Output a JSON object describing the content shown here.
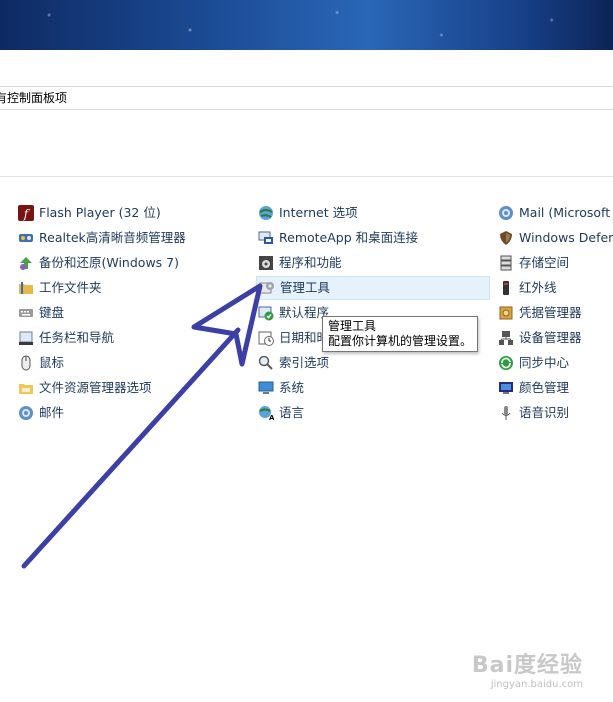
{
  "address_bar": {
    "text": "有控制面板项"
  },
  "columns": {
    "left": [
      {
        "label": "Flash Player (32 位)",
        "icon": "flash-icon"
      },
      {
        "label": "Realtek高清晰音频管理器",
        "icon": "audio-icon"
      },
      {
        "label": "备份和还原(Windows 7)",
        "icon": "backup-icon"
      },
      {
        "label": "工作文件夹",
        "icon": "folder-icon"
      },
      {
        "label": "键盘",
        "icon": "keyboard-icon"
      },
      {
        "label": "任务栏和导航",
        "icon": "taskbar-icon"
      },
      {
        "label": "鼠标",
        "icon": "mouse-icon"
      },
      {
        "label": "文件资源管理器选项",
        "icon": "folder-options-icon"
      },
      {
        "label": "邮件",
        "icon": "mail-icon"
      }
    ],
    "middle": [
      {
        "label": "Internet 选项",
        "icon": "internet-icon"
      },
      {
        "label": "RemoteApp 和桌面连接",
        "icon": "remote-icon"
      },
      {
        "label": "程序和功能",
        "icon": "programs-icon"
      },
      {
        "label": "管理工具",
        "icon": "admin-tools-icon"
      },
      {
        "label": "默认程序",
        "icon": "default-programs-icon"
      },
      {
        "label": "日期和时",
        "icon": "datetime-icon"
      },
      {
        "label": "索引选项",
        "icon": "index-icon"
      },
      {
        "label": "系统",
        "icon": "system-icon"
      },
      {
        "label": "语言",
        "icon": "language-icon"
      }
    ],
    "right": [
      {
        "label": "Mail (Microsoft (",
        "icon": "mail-icon"
      },
      {
        "label": "Windows Defend",
        "icon": "defender-icon"
      },
      {
        "label": "存储空间",
        "icon": "storage-icon"
      },
      {
        "label": "红外线",
        "icon": "infrared-icon"
      },
      {
        "label": "凭据管理器",
        "icon": "credential-icon"
      },
      {
        "label": "设备管理器",
        "icon": "device-manager-icon"
      },
      {
        "label": "同步中心",
        "icon": "sync-icon"
      },
      {
        "label": "颜色管理",
        "icon": "color-icon"
      },
      {
        "label": "语音识别",
        "icon": "speech-icon"
      }
    ]
  },
  "tooltip": {
    "title": "管理工具",
    "description": "配置你计算机的管理设置。"
  },
  "watermark": {
    "brand": "Bai度经验",
    "url": "jingyan.baidu.com"
  },
  "colors": {
    "link": "#1e395b",
    "hover_bg": "#e5f1fb",
    "arrow": "#3b3fa6"
  }
}
